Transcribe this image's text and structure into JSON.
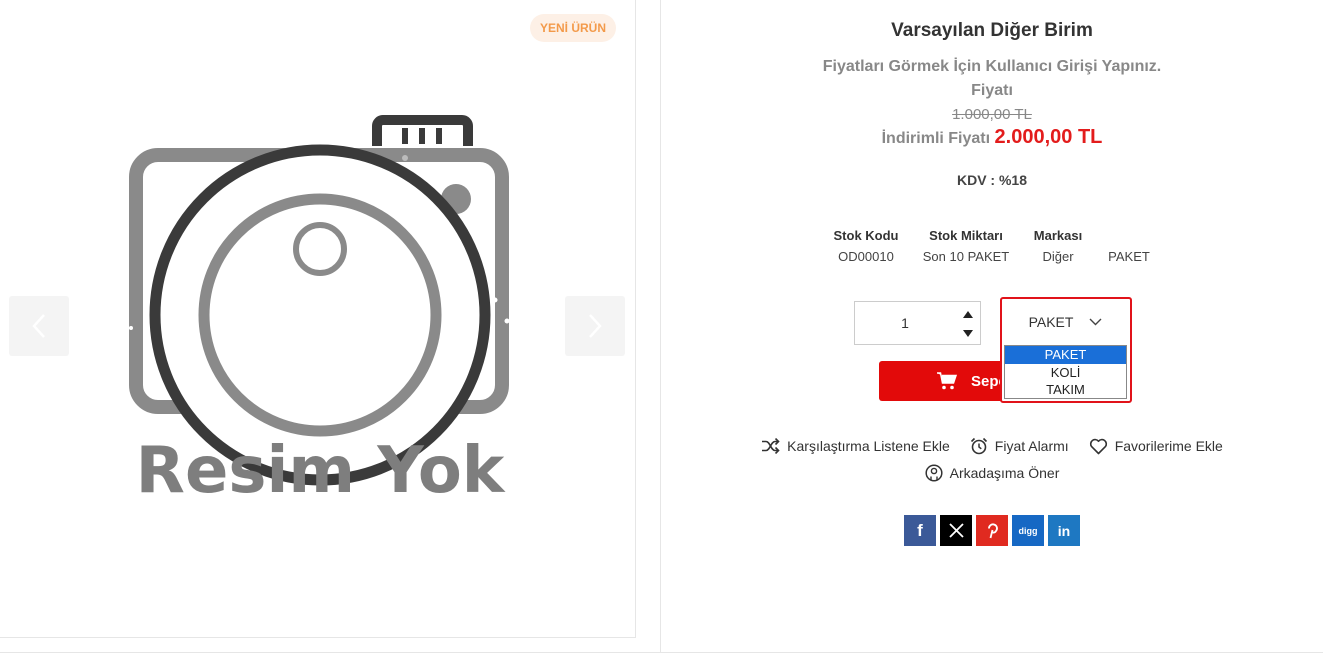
{
  "gallery": {
    "badge": "YENİ ÜRÜN",
    "placeholder_text": "Resim Yok"
  },
  "product": {
    "title": "Varsayılan Diğer Birim",
    "login_note": "Fiyatları Görmek İçin Kullanıcı Girişi Yapınız.",
    "price_label": "Fiyatı",
    "old_price": "1.000,00 TL",
    "discount_label": "İndirimli Fiyatı",
    "discount_price": "2.000,00 TL",
    "kdv": "KDV : %18"
  },
  "stock": {
    "headers": [
      "Stok Kodu",
      "Stok Miktarı",
      "Markası"
    ],
    "values": [
      "OD00010",
      "Son 10 PAKET",
      "Diğer",
      "PAKET"
    ]
  },
  "quantity": {
    "value": "1"
  },
  "unit_select": {
    "selected": "PAKET",
    "options": [
      "PAKET",
      "KOLİ",
      "TAKIM"
    ]
  },
  "cart": {
    "label": "Sepete Ekle"
  },
  "actions": {
    "compare": "Karşılaştırma Listene Ekle",
    "alarm": "Fiyat Alarmı",
    "favorites": "Favorilerime Ekle",
    "recommend": "Arkadaşıma Öner"
  },
  "share": {
    "facebook": "f",
    "x": "X",
    "pinterest": "P",
    "digg": "digg",
    "linkedin": "in"
  },
  "colors": {
    "accent_red": "#e20a0a",
    "badge_text": "#f39a4a",
    "badge_bg": "#fdf0e6",
    "select_highlight": "#1a6fd8"
  }
}
